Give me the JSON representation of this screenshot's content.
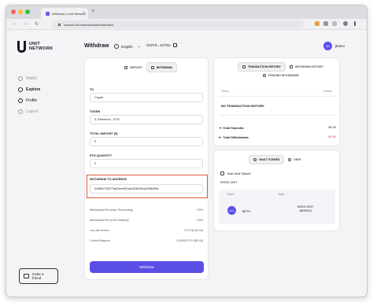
{
  "browser": {
    "tab_title": "Withdraw | Unit Network",
    "tab_close": "×",
    "new_tab": "+",
    "url": "mozart.unit.network/wallet/withdraw",
    "back": "←",
    "forward": "→",
    "reload": "↻"
  },
  "sidebar": {
    "logo_line1": "UNIT",
    "logo_line2": "NETWORK",
    "items": [
      {
        "label": "Wallet"
      },
      {
        "label": "Explore"
      },
      {
        "label": "Profile"
      },
      {
        "label": "Logout"
      }
    ],
    "invite_line1": "Invite a",
    "invite_line2": "friend"
  },
  "header": {
    "title": "Withdraw",
    "language": "English",
    "language_chevron": "⌄",
    "address": "SCPrE...5J7No",
    "user_initials": "AN",
    "user_name": "jkamo"
  },
  "withdraw_card": {
    "tabs": [
      {
        "label": "DEPOSIT"
      },
      {
        "label": "WITHDRAW"
      }
    ],
    "to_label": "TO",
    "to_value": "Crypto",
    "token_label": "TOKEN",
    "token_value": "2. Ethereum - ETH",
    "total_label": "TOTAL AMOUNT ($)",
    "total_value": "0",
    "eth_qty_label": "ETH QUANTITY",
    "eth_qty_value": "0",
    "address_label": "WITHDRAW TO ADDRESS",
    "address_value": "0x85fc276377aa1eeef910ac32a005ea2256c59a",
    "info": [
      {
        "k": "Withdrawal Fee (User Processing)",
        "v": "0.5%"
      },
      {
        "k": "Withdrawal Fee (Unit Treasury)",
        "v": "0.5%"
      },
      {
        "k": "You will receive",
        "v": "0 ETH(/ $0.00)"
      },
      {
        "k": "Current Balance",
        "v": "0.00000 ETH ($0.00)"
      }
    ],
    "button": "Withdraw"
  },
  "history_card": {
    "tabs": [
      {
        "label": "TRANSACTION HISTORY"
      },
      {
        "label": "WITHDRAW HISTORY"
      }
    ],
    "pending_tab": "PENDING WITHDRAWS",
    "col_token": "Token",
    "col_status": "Status",
    "empty": "NO TRANSACTION HISTORY",
    "total_deposits_label": "Total Deposits:",
    "total_deposits_value": "$0.00",
    "total_withdrawals_label": "Total Withdrawals:",
    "total_withdrawals_value": "-$0.00"
  },
  "vault_card": {
    "tabs": [
      {
        "label": "VAULT STAKED"
      },
      {
        "label": "VIEW"
      }
    ],
    "total_label": "Total Vault Staked:",
    "total_value": "50000 UNIT",
    "col_token": "Token",
    "col_total": "Total",
    "token_badge": "ETH",
    "token_name": "$ETH",
    "balance_line1": "50000 UNIT",
    "balance_line2": "($25000)"
  },
  "colors": {
    "accent": "#5b4ee6",
    "highlight_border": "#e05a36",
    "negative": "#e0453a"
  }
}
